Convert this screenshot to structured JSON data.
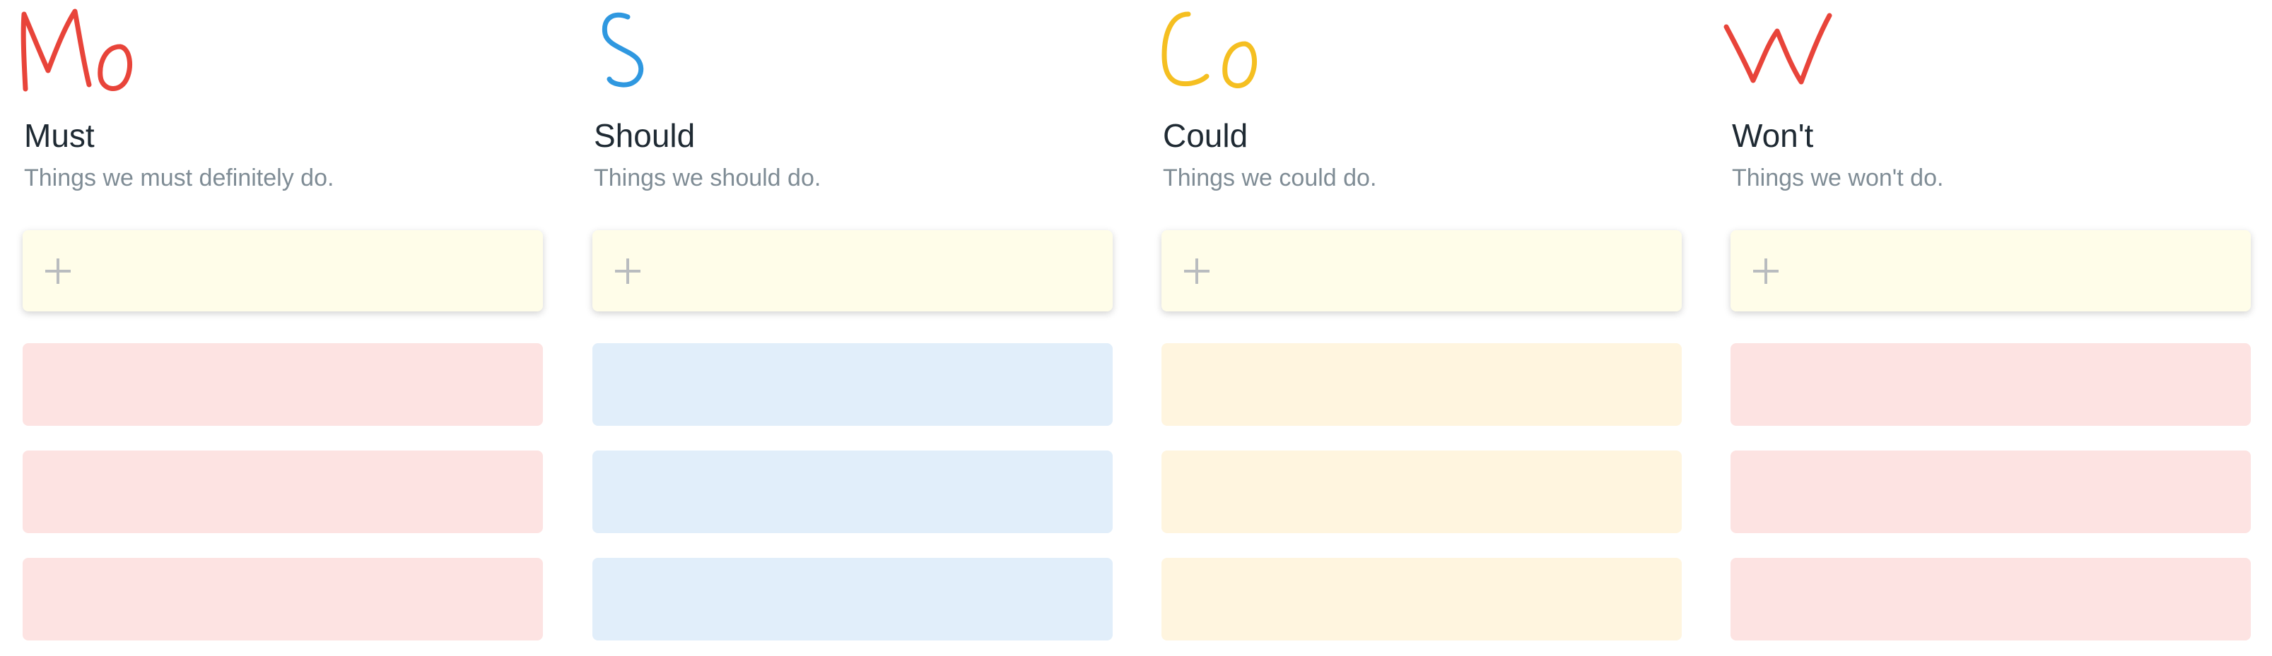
{
  "columns": [
    {
      "scribble": "Mo",
      "title": "Must",
      "description": "Things we must definitely do.",
      "add_icon": "plus-icon",
      "accent_color": "#e8443a",
      "card_color": "#fde3e2",
      "card_count": 3
    },
    {
      "scribble": "S",
      "title": "Should",
      "description": "Things we should do.",
      "add_icon": "plus-icon",
      "accent_color": "#2f98e0",
      "card_color": "#e1eefa",
      "card_count": 3
    },
    {
      "scribble": "Co",
      "title": "Could",
      "description": "Things we could do.",
      "add_icon": "plus-icon",
      "accent_color": "#f5bf21",
      "card_color": "#fff5df",
      "card_count": 3
    },
    {
      "scribble": "W",
      "title": "Won't",
      "description": "Things we won't do.",
      "add_icon": "plus-icon",
      "accent_color": "#e8443a",
      "card_color": "#fde3e2",
      "card_count": 3
    }
  ],
  "add_card_color": "#fffde9"
}
